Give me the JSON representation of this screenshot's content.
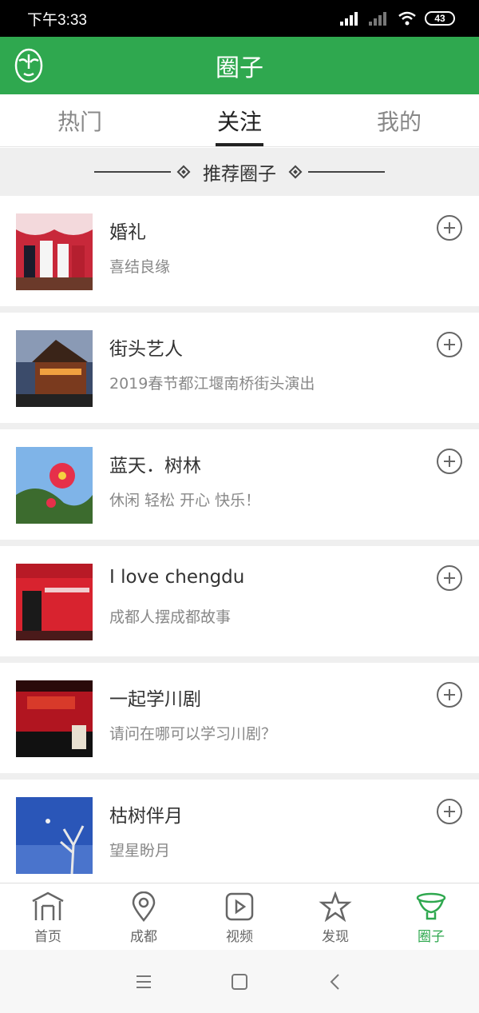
{
  "status_bar": {
    "time": "下午3:33",
    "battery": "43"
  },
  "header": {
    "title": "圈子"
  },
  "tabs": [
    {
      "label": "热门"
    },
    {
      "label": "关注"
    },
    {
      "label": "我的"
    }
  ],
  "section": {
    "title": "推荐圈子"
  },
  "circles": [
    {
      "title": "婚礼",
      "subtitle": "喜结良缘"
    },
    {
      "title": "街头艺人",
      "subtitle": "2019春节都江堰南桥街头演出"
    },
    {
      "title": "蓝天．树林",
      "subtitle": "休闲 轻松 开心 快乐！"
    },
    {
      "title": "I love chengdu",
      "subtitle": "成都人摆成都故事"
    },
    {
      "title": "一起学川剧",
      "subtitle": "请问在哪可以学习川剧？"
    },
    {
      "title": "枯树伴月",
      "subtitle": "望星盼月"
    }
  ],
  "bottom_nav": [
    {
      "label": "首页",
      "icon": "home-gate-icon"
    },
    {
      "label": "成都",
      "icon": "location-pin-icon"
    },
    {
      "label": "视频",
      "icon": "video-play-icon"
    },
    {
      "label": "发现",
      "icon": "discover-star-icon"
    },
    {
      "label": "圈子",
      "icon": "circle-cup-icon"
    }
  ],
  "colors": {
    "brand_green": "#2fa84f",
    "text": "#333333",
    "muted": "#888888"
  }
}
